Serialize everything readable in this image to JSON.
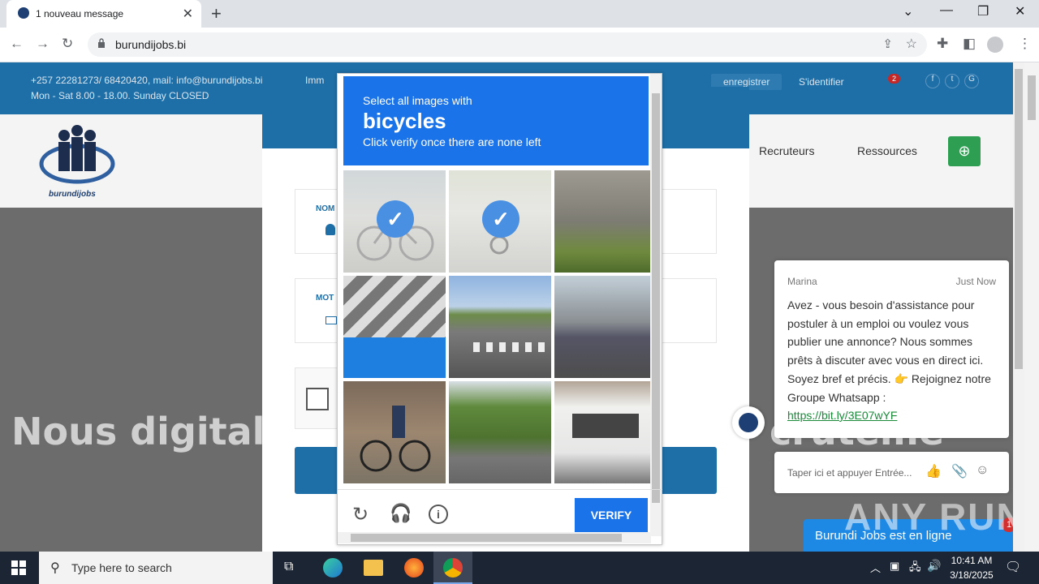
{
  "browser": {
    "tab_title": "1 nouveau message",
    "url": "burundijobs.bi"
  },
  "site": {
    "contact": "+257 22281273/ 68420420, mail: info@burundijobs.bi",
    "hours": "Mon - Sat 8.00 - 18.00. Sunday CLOSED",
    "address_fragment": "Imm",
    "register_label": "enregistrer",
    "login_label": "S'identifier",
    "notif_count": "2",
    "logo_text": "burundijobs",
    "nav": [
      "Recruteurs",
      "Ressources"
    ],
    "hero_left": "Nous digitalis",
    "hero_right": "cruteme",
    "field1_label": "NOM",
    "field2_label": "MOT"
  },
  "captcha": {
    "instruction": "Select all images with",
    "target": "bicycles",
    "subtext": "Click verify once there are none left",
    "verify_label": "VERIFY",
    "tiles": [
      {
        "name": "tile-1",
        "selected": true
      },
      {
        "name": "tile-2",
        "selected": true
      },
      {
        "name": "tile-3",
        "selected": false
      },
      {
        "name": "tile-4",
        "selected": false
      },
      {
        "name": "tile-5",
        "selected": false
      },
      {
        "name": "tile-6",
        "selected": false
      },
      {
        "name": "tile-7",
        "selected": false
      },
      {
        "name": "tile-8",
        "selected": false
      },
      {
        "name": "tile-9",
        "selected": false
      }
    ]
  },
  "chat": {
    "agent": "Marina",
    "time": "Just Now",
    "message": "Avez - vous besoin d'assistance pour postuler à un emploi ou voulez vous publier une annonce? Nous sommes prêts à discuter avec vous en direct ici. Soyez bref et précis. 👉 Rejoignez notre Groupe Whatsapp :",
    "link": "https://bit.ly/3E07wYF",
    "input_placeholder": "Taper ici et appuyer Entrée...",
    "online_label": "Burundi Jobs est en ligne",
    "badge": "1"
  },
  "watermark": "ANY RUN",
  "taskbar": {
    "search_placeholder": "Type here to search",
    "time": "10:41 AM",
    "date": "3/18/2025"
  }
}
